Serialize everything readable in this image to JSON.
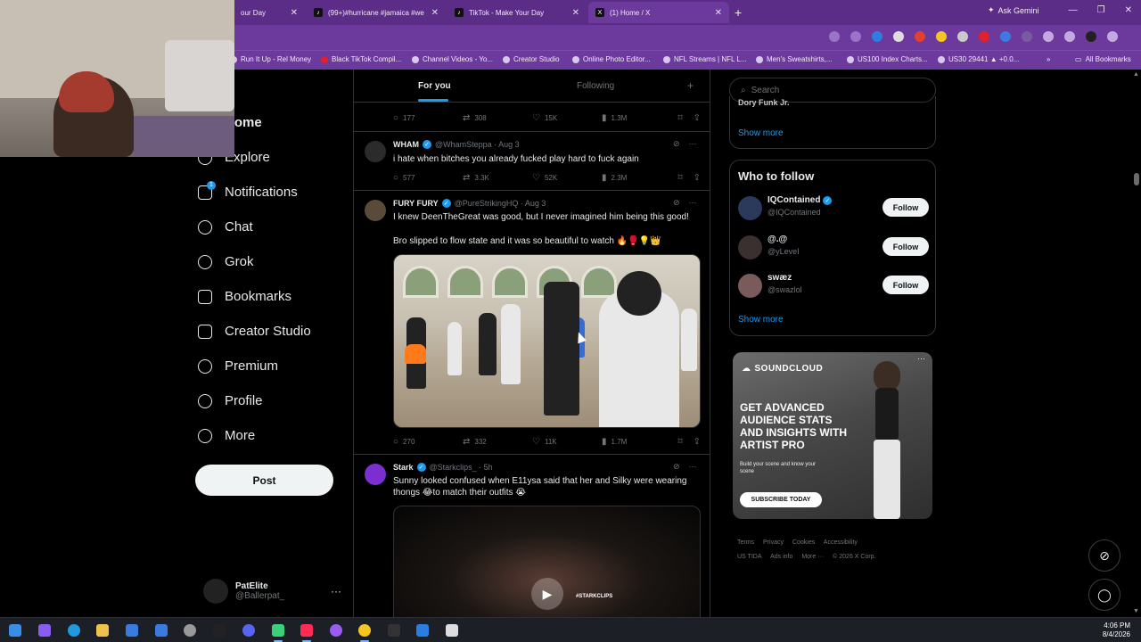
{
  "browser": {
    "tabs": [
      {
        "title": "our Day",
        "active": false
      },
      {
        "title": "(99+)#hurricane #jamaica #we",
        "active": false
      },
      {
        "title": "TikTok - Make Your Day",
        "active": false
      },
      {
        "title": "(1) Home / X",
        "active": true
      }
    ],
    "new_tab": "+",
    "gemini": "Ask Gemini",
    "bookmarks": [
      "Run It Up - Rel Money",
      "Black TikTok Compil...",
      "Channel Videos - Yo...",
      "Creator Studio",
      "Online Photo Editor...",
      "NFL Streams | NFL L...",
      "Men's Sweatshirts,...",
      "US100 Index Charts...",
      "US30 29441 ▲ +0.0..."
    ],
    "bookmarks_overflow": "»",
    "all_bookmarks": "All Bookmarks"
  },
  "nav": {
    "items": [
      {
        "label": "Home",
        "icon": "home-icon"
      },
      {
        "label": "Explore",
        "icon": "search-icon"
      },
      {
        "label": "Notifications",
        "icon": "bell-icon",
        "badge": "1"
      },
      {
        "label": "Chat",
        "icon": "chat-icon"
      },
      {
        "label": "Grok",
        "icon": "grok-icon"
      },
      {
        "label": "Bookmarks",
        "icon": "bookmark-icon"
      },
      {
        "label": "Creator Studio",
        "icon": "rocket-icon"
      },
      {
        "label": "Premium",
        "icon": "verified-icon"
      },
      {
        "label": "Profile",
        "icon": "person-icon"
      },
      {
        "label": "More",
        "icon": "more-circle-icon"
      }
    ],
    "post_label": "Post",
    "account": {
      "name": "PatElite",
      "handle": "@Ballerpat_",
      "more": "···"
    }
  },
  "timeline": {
    "tabs": {
      "for_you": "For you",
      "following": "Following",
      "add": "+"
    },
    "top_actions": {
      "replies": "177",
      "reposts": "308",
      "likes": "15K",
      "views": "1.3M"
    },
    "tweets": [
      {
        "name": "WHAM",
        "meta": "@WhamSteppa · Aug 3",
        "text": "i hate when bitches you already fucked play hard to fuck again",
        "replies": "577",
        "reposts": "3.3K",
        "likes": "52K",
        "views": "2.3M"
      },
      {
        "name": "FURY FURY",
        "meta": "@PureStrikingHQ · Aug 3",
        "text": "I knew DeenTheGreat was good, but I never imagined him being this good!",
        "text2": "Bro slipped to flow state and it was so beautiful to watch 🔥🥊💡👑",
        "replies": "270",
        "reposts": "332",
        "likes": "11K",
        "views": "1.7M"
      },
      {
        "name": "Stark",
        "meta": "@Starkclips_ · 5h",
        "text": "Sunny looked confused when E11ysa said that her and Silky were wearing thongs 😂to match their outfits 😭",
        "clip_tag": "#STARKCLIPS"
      }
    ]
  },
  "right": {
    "search_placeholder": "Search",
    "trend_cut": "Dory Funk Jr.",
    "show_more": "Show more",
    "who_to_follow": {
      "title": "Who to follow",
      "users": [
        {
          "name": "IQContained",
          "handle": "@IQContained",
          "verified": true
        },
        {
          "name": "@.@",
          "handle": "@yLeveI",
          "verified": false
        },
        {
          "name": "swæz",
          "handle": "@swazlol",
          "verified": false
        }
      ],
      "follow_label": "Follow",
      "show_more": "Show more"
    },
    "ad": {
      "brand": "SOUNDCLOUD",
      "headline": "GET ADVANCED AUDIENCE STATS AND INSIGHTS WITH ARTIST PRO",
      "sub": "Build your scene and know your scene",
      "cta": "SUBSCRIBE TODAY",
      "more": "···"
    },
    "footer": [
      "Terms",
      "Privacy",
      "Cookies",
      "Accessibility",
      "US TIDA",
      "Ads info",
      "More ···",
      "© 2026 X Corp."
    ]
  },
  "taskbar": {
    "time": "4:06 PM",
    "date": "8/4/2026"
  },
  "colors": {
    "accent": "#1d9bf0",
    "browser_frame": "#6c3a9c",
    "background": "#000000"
  }
}
